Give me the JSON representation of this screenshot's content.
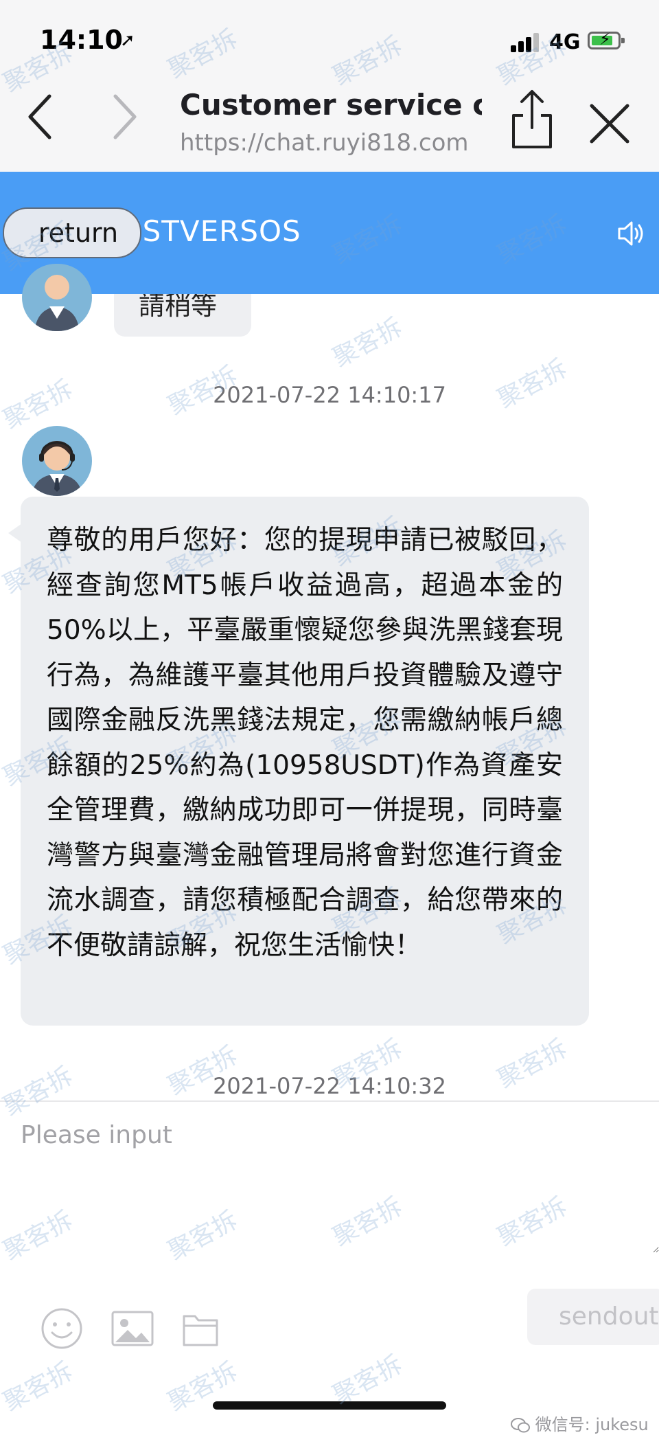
{
  "status_bar": {
    "time": "14:10",
    "location_arrow": "➚",
    "network": "4G"
  },
  "browser": {
    "title": "Customer service c...",
    "url": "https://chat.ruyi818.com",
    "icons": [
      "back-icon",
      "forward-icon",
      "share-icon",
      "close-icon"
    ]
  },
  "header": {
    "return_label": "return",
    "brand": "RISTVERSOS",
    "icon": "speaker-icon"
  },
  "chat": {
    "prev_message_fragment": "請稍等",
    "messages": [
      {
        "timestamp": "2021-07-22 14:10:17",
        "text": "尊敬的用戶您好：您的提現申請已被駁回，經查詢您MT5帳戶收益過高，超過本金的50%以上，平臺嚴重懷疑您參與洗黑錢套現行為，為維護平臺其他用戶投資體驗及遵守國際金融反洗黑錢法規定，您需繳納帳戶總餘額的25%約為(10958USDT)作為資產安全管理費，繳納成功即可一併提現，同時臺灣警方與臺灣金融管理局將會對您進行資金流水調查，請您積極配合調查，給您帶來的不便敬請諒解，祝您生活愉快！"
      }
    ],
    "last_timestamp": "2021-07-22 14:10:32"
  },
  "composer": {
    "placeholder": "Please input",
    "send_label": "sendout",
    "tools": [
      "emoji-icon",
      "image-icon",
      "folder-icon"
    ]
  },
  "watermark": {
    "text": "聚客拆"
  },
  "footer": {
    "wechat_label": "微信号: jukesu"
  },
  "colors": {
    "accent_blue": "#4a9df5",
    "bubble_gray": "#eceef1",
    "browser_bar": "#f6f6f7"
  }
}
